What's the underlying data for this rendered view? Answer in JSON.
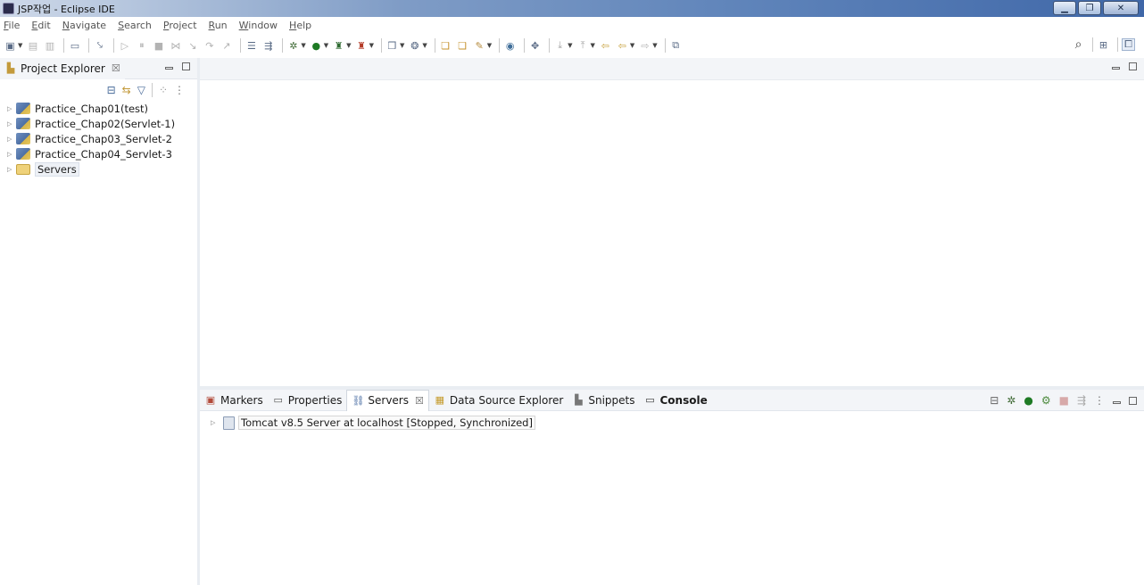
{
  "window": {
    "title": "JSP작업 - Eclipse IDE",
    "minimize": "▁",
    "restore": "❐",
    "close": "✕"
  },
  "menu": {
    "items": [
      "File",
      "Edit",
      "Navigate",
      "Search",
      "Project",
      "Run",
      "Window",
      "Help"
    ]
  },
  "toolbar": {
    "icons": [
      "new-icon",
      "save-icon",
      "save-all-icon",
      "terminal-icon",
      "skip-breakpoints-icon",
      "resume-icon",
      "suspend-icon",
      "terminate-icon",
      "disconnect-icon",
      "step-into-icon",
      "step-over-icon",
      "step-return-icon",
      "drop-to-frame-icon",
      "use-step-filters-icon",
      "debug-icon",
      "run-icon",
      "run-last-tool-icon",
      "coverage-icon",
      "new-server-icon",
      "new-package-icon",
      "open-type-icon",
      "open-task-icon",
      "next-annotation-icon",
      "globe-icon",
      "ant-icon",
      "back-icon",
      "forward-icon",
      "pin-editor-icon"
    ],
    "search_icon": "search-icon",
    "perspective_icons": [
      "open-perspective-icon",
      "java-ee-perspective-icon"
    ]
  },
  "project_explorer": {
    "title": "Project Explorer",
    "close": "☒",
    "items": [
      {
        "label": "Practice_Chap01(test)",
        "type": "project"
      },
      {
        "label": "Practice_Chap02(Servlet-1)",
        "type": "project"
      },
      {
        "label": "Practice_Chap03_Servlet-2",
        "type": "project"
      },
      {
        "label": "Practice_Chap04_Servlet-3",
        "type": "project"
      },
      {
        "label": "Servers",
        "type": "folder"
      }
    ]
  },
  "bottom_panel": {
    "tabs": [
      {
        "label": "Markers",
        "icon": "markers-icon"
      },
      {
        "label": "Properties",
        "icon": "properties-icon"
      },
      {
        "label": "Servers",
        "icon": "servers-icon",
        "active": true
      },
      {
        "label": "Data Source Explorer",
        "icon": "data-source-icon"
      },
      {
        "label": "Snippets",
        "icon": "snippets-icon"
      },
      {
        "label": "Console",
        "icon": "console-icon",
        "bold": true
      }
    ],
    "close": "☒",
    "server_entry": "Tomcat v8.5 Server at localhost  [Stopped, Synchronized]"
  },
  "colors": {
    "accent": "#4c6fa4",
    "panel_header": "#f3f5f8",
    "divider": "#e9edf2"
  }
}
